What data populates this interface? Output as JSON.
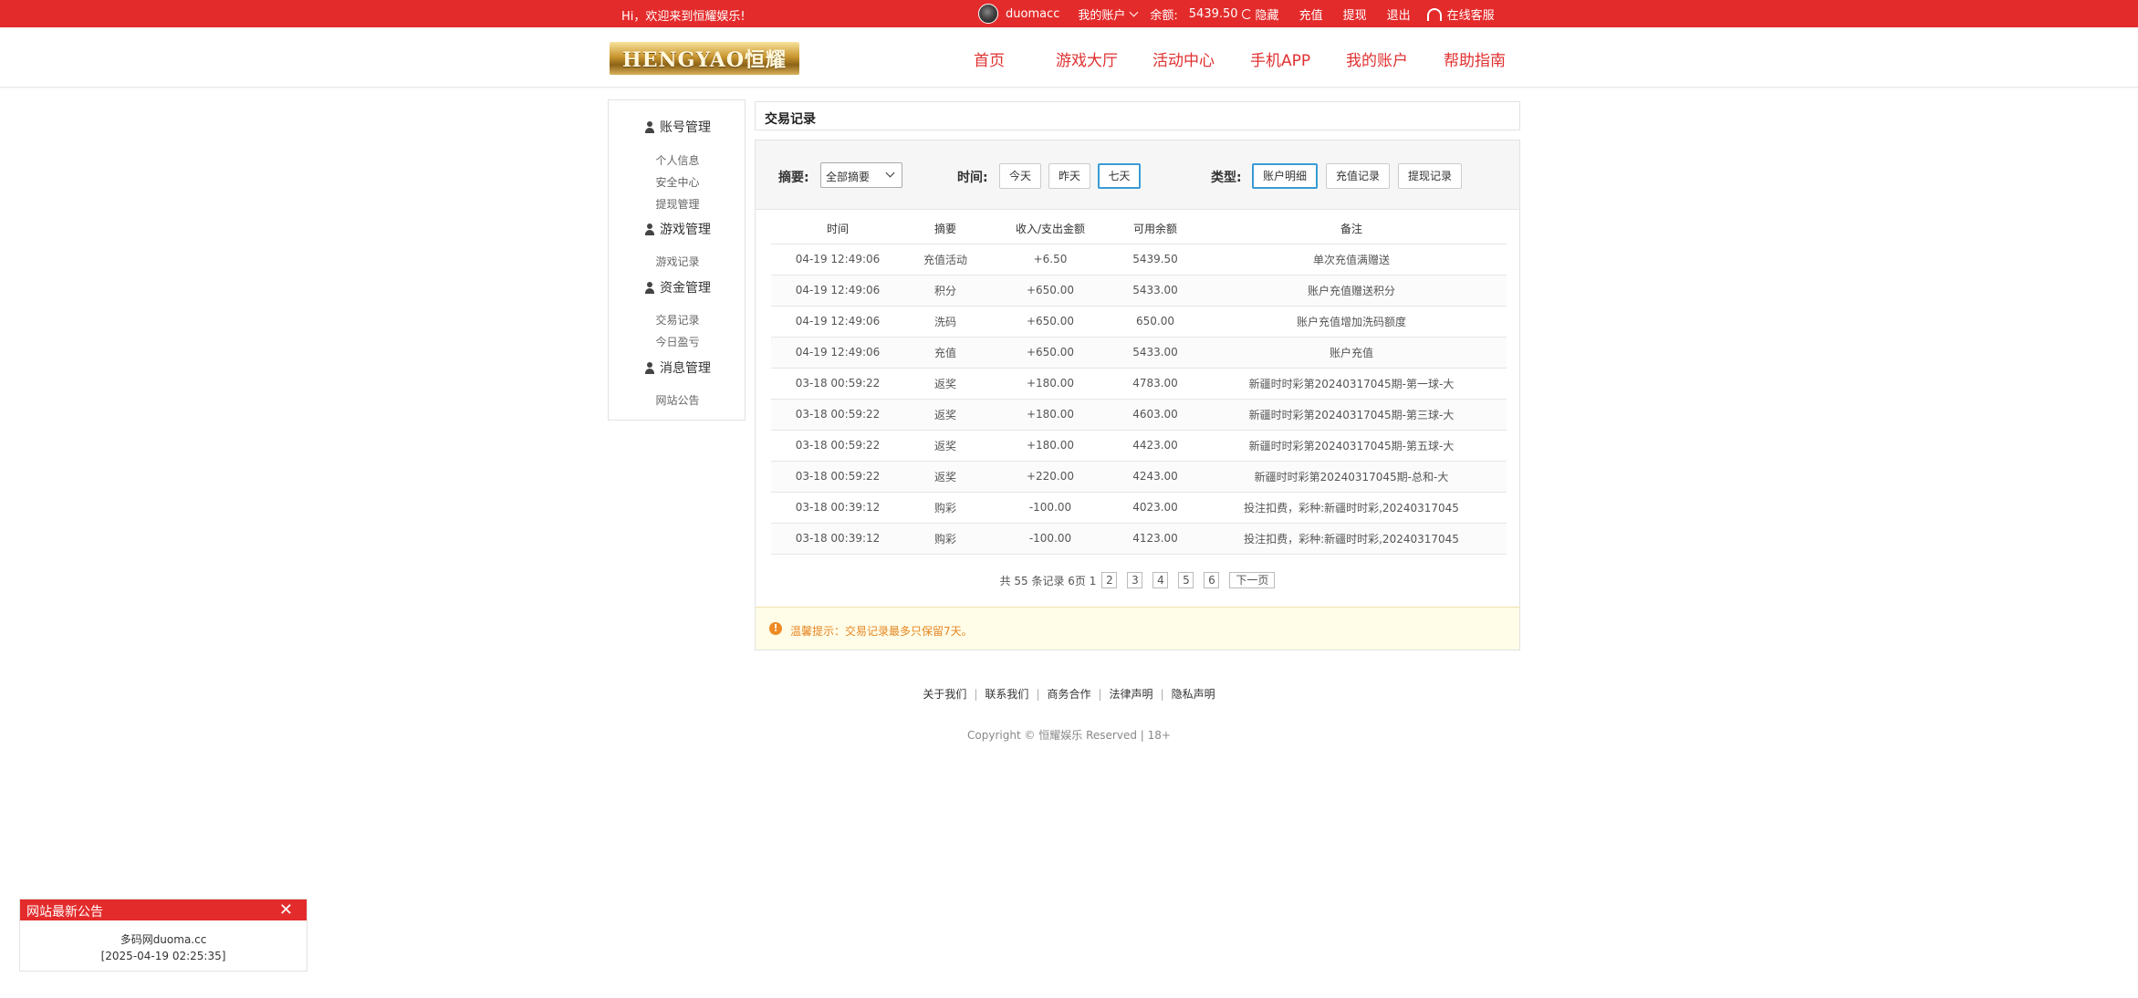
{
  "topbar": {
    "welcome": "Hi，欢迎来到恒耀娱乐!",
    "username": "duomacc",
    "my_account": "我的账户",
    "balance_label": "余额:",
    "balance_value": "5439.50",
    "hide": "隐藏",
    "recharge": "充值",
    "withdraw": "提现",
    "logout": "退出",
    "customer_service": "在线客服",
    "bg_color": "#e42b2b"
  },
  "logo": {
    "text": "HENGYAO恒耀"
  },
  "nav": [
    "首页",
    "游戏大厅",
    "活动中心",
    "手机APP",
    "我的账户",
    "帮助指南"
  ],
  "sidebar": {
    "groups": [
      {
        "title": "账号管理",
        "items": [
          "个人信息",
          "安全中心",
          "提现管理"
        ]
      },
      {
        "title": "游戏管理",
        "items": [
          "游戏记录"
        ]
      },
      {
        "title": "资金管理",
        "items": [
          "交易记录",
          "今日盈亏"
        ]
      },
      {
        "title": "消息管理",
        "items": [
          "网站公告"
        ]
      }
    ]
  },
  "main": {
    "title": "交易记录",
    "filter": {
      "summary_label": "摘要:",
      "summary_selected": "全部摘要",
      "time_label": "时间:",
      "time_buttons": [
        "今天",
        "昨天",
        "七天"
      ],
      "time_active": "七天",
      "type_label": "类型:",
      "type_buttons": [
        "账户明细",
        "充值记录",
        "提现记录"
      ],
      "type_active": "账户明细"
    },
    "table": {
      "columns": [
        "时间",
        "摘要",
        "收入/支出金额",
        "可用余额",
        "备注"
      ],
      "rows": [
        [
          "04-19 12:49:06",
          "充值活动",
          "+6.50",
          "5439.50",
          "单次充值满赠送"
        ],
        [
          "04-19 12:49:06",
          "积分",
          "+650.00",
          "5433.00",
          "账户充值赠送积分"
        ],
        [
          "04-19 12:49:06",
          "洗码",
          "+650.00",
          "650.00",
          "账户充值增加洗码额度"
        ],
        [
          "04-19 12:49:06",
          "充值",
          "+650.00",
          "5433.00",
          "账户充值"
        ],
        [
          "03-18 00:59:22",
          "返奖",
          "+180.00",
          "4783.00",
          "新疆时时彩第20240317045期-第一球-大"
        ],
        [
          "03-18 00:59:22",
          "返奖",
          "+180.00",
          "4603.00",
          "新疆时时彩第20240317045期-第三球-大"
        ],
        [
          "03-18 00:59:22",
          "返奖",
          "+180.00",
          "4423.00",
          "新疆时时彩第20240317045期-第五球-大"
        ],
        [
          "03-18 00:59:22",
          "返奖",
          "+220.00",
          "4243.00",
          "新疆时时彩第20240317045期-总和-大"
        ],
        [
          "03-18 00:39:12",
          "购彩",
          "-100.00",
          "4023.00",
          "投注扣费，彩种:新疆时时彩,20240317045"
        ],
        [
          "03-18 00:39:12",
          "购彩",
          "-100.00",
          "4123.00",
          "投注扣费，彩种:新疆时时彩,20240317045"
        ]
      ]
    },
    "pager": {
      "summary": "共 55 条记录 6页 1",
      "pages": [
        "2",
        "3",
        "4",
        "5",
        "6"
      ],
      "next": "下一页"
    },
    "notice": "温馨提示：交易记录最多只保留7天。"
  },
  "footer": {
    "links": [
      "关于我们",
      "联系我们",
      "商务合作",
      "法律声明",
      "隐私声明"
    ],
    "copyright": "Copyright © 恒耀娱乐 Reserved | 18+"
  },
  "popup": {
    "title": "网站最新公告",
    "line1": "多码网duoma.cc",
    "line2": "[2025-04-19 02:25:35]"
  }
}
